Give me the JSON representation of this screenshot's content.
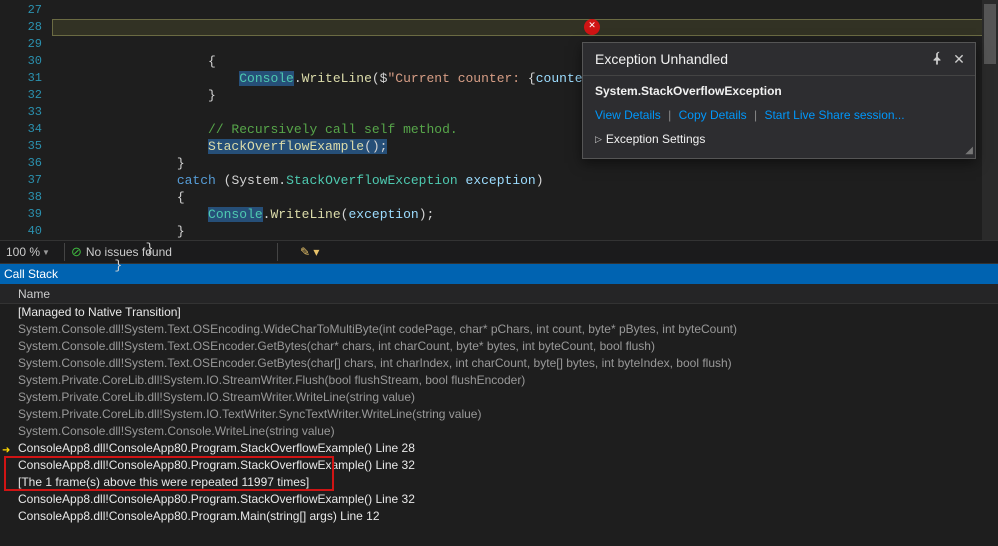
{
  "editor": {
    "line_start": 27,
    "lines": [
      {
        "indent": 20,
        "tokens": [
          {
            "cls": "tok-punc",
            "t": "{"
          }
        ]
      },
      {
        "indent": 24,
        "marker": "yellow",
        "tokens": [
          {
            "cls": "tok-type sel",
            "t": "Console"
          },
          {
            "cls": "tok-punc",
            "t": "."
          },
          {
            "cls": "tok-mth",
            "t": "WriteLine"
          },
          {
            "cls": "tok-punc",
            "t": "($"
          },
          {
            "cls": "tok-str",
            "t": "\"Current counter: "
          },
          {
            "cls": "tok-punc",
            "t": "{"
          },
          {
            "cls": "tok-id",
            "t": "counter"
          },
          {
            "cls": "tok-punc",
            "t": "}"
          },
          {
            "cls": "tok-str",
            "t": ".\""
          },
          {
            "cls": "tok-punc",
            "t": ");"
          }
        ]
      },
      {
        "indent": 20,
        "tokens": [
          {
            "cls": "tok-punc",
            "t": "}"
          }
        ]
      },
      {
        "indent": 0,
        "tokens": []
      },
      {
        "indent": 20,
        "tokens": [
          {
            "cls": "tok-cm",
            "t": "// Recursively call self method."
          }
        ]
      },
      {
        "indent": 20,
        "tokens": [
          {
            "cls": "tok-mth sel",
            "t": "StackOverflowExample"
          },
          {
            "cls": "tok-punc sel",
            "t": "();"
          }
        ]
      },
      {
        "indent": 16,
        "tokens": [
          {
            "cls": "tok-punc",
            "t": "}"
          }
        ]
      },
      {
        "indent": 16,
        "tokens": [
          {
            "cls": "tok-kw",
            "t": "catch"
          },
          {
            "cls": "tok-punc",
            "t": " ("
          },
          {
            "cls": "tok-punc",
            "t": "System."
          },
          {
            "cls": "tok-type",
            "t": "StackOverflowException"
          },
          {
            "cls": "tok-punc",
            "t": " "
          },
          {
            "cls": "tok-id",
            "t": "exception"
          },
          {
            "cls": "tok-punc",
            "t": ")"
          }
        ]
      },
      {
        "indent": 16,
        "tokens": [
          {
            "cls": "tok-punc",
            "t": "{"
          }
        ]
      },
      {
        "indent": 20,
        "tokens": [
          {
            "cls": "tok-type sel",
            "t": "Console"
          },
          {
            "cls": "tok-punc",
            "t": "."
          },
          {
            "cls": "tok-mth",
            "t": "WriteLine"
          },
          {
            "cls": "tok-punc",
            "t": "("
          },
          {
            "cls": "tok-id",
            "t": "exception"
          },
          {
            "cls": "tok-punc",
            "t": ");"
          }
        ]
      },
      {
        "indent": 16,
        "tokens": [
          {
            "cls": "tok-punc",
            "t": "}"
          }
        ]
      },
      {
        "indent": 12,
        "tokens": [
          {
            "cls": "tok-punc",
            "t": "}"
          }
        ]
      },
      {
        "indent": 8,
        "tokens": [
          {
            "cls": "tok-punc",
            "t": "}"
          }
        ]
      },
      {
        "indent": 0,
        "tokens": []
      }
    ]
  },
  "stop_icon": "✕",
  "exception": {
    "title": "Exception Unhandled",
    "type": "System.StackOverflowException",
    "link_view": "View Details",
    "link_copy": "Copy Details",
    "link_live": "Start Live Share session...",
    "settings": "Exception Settings"
  },
  "status": {
    "zoom": "100 %",
    "issues": "No issues found"
  },
  "callstack": {
    "title": "Call Stack",
    "column": "Name",
    "rows": [
      {
        "txt": "[Managed to Native Transition]",
        "active": true
      },
      {
        "txt": "System.Console.dll!System.Text.OSEncoding.WideCharToMultiByte(int codePage, char* pChars, int count, byte* pBytes, int byteCount)"
      },
      {
        "txt": "System.Console.dll!System.Text.OSEncoder.GetBytes(char* chars, int charCount, byte* bytes, int byteCount, bool flush)"
      },
      {
        "txt": "System.Console.dll!System.Text.OSEncoder.GetBytes(char[] chars, int charIndex, int charCount, byte[] bytes, int byteIndex, bool flush)"
      },
      {
        "txt": "System.Private.CoreLib.dll!System.IO.StreamWriter.Flush(bool flushStream, bool flushEncoder)"
      },
      {
        "txt": "System.Private.CoreLib.dll!System.IO.StreamWriter.WriteLine(string value)"
      },
      {
        "txt": "System.Private.CoreLib.dll!System.IO.TextWriter.SyncTextWriter.WriteLine(string value)"
      },
      {
        "txt": "System.Console.dll!System.Console.WriteLine(string value)"
      },
      {
        "txt": "ConsoleApp8.dll!ConsoleApp80.Program.StackOverflowExample() Line 28",
        "active": true,
        "arrow": true
      },
      {
        "txt": "ConsoleApp8.dll!ConsoleApp80.Program.StackOverflowExample() Line 32",
        "active": true,
        "redtop": true
      },
      {
        "txt": "[The 1 frame(s) above this were repeated 11997 times]",
        "active": true,
        "redbot": true
      },
      {
        "txt": "ConsoleApp8.dll!ConsoleApp80.Program.StackOverflowExample() Line 32",
        "active": true
      },
      {
        "txt": "ConsoleApp8.dll!ConsoleApp80.Program.Main(string[] args) Line 12",
        "active": true
      }
    ]
  }
}
